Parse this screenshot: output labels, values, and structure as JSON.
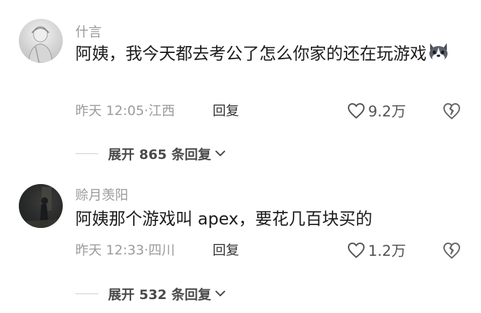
{
  "comments": [
    {
      "username": "什言",
      "text": "阿姨，我今天都去考公了怎么你家的还在玩游戏",
      "emoji": "husky-dog-emoji",
      "time": "昨天 12:05",
      "location": "江西",
      "reply_label": "回复",
      "likes": "9.2万",
      "expand_label": "展开 865 条回复"
    },
    {
      "username": "赊月羡阳",
      "text": "阿姨那个游戏叫 apex，要花几百块买的",
      "time": "昨天 12:33",
      "location": "四川",
      "reply_label": "回复",
      "likes": "1.2万",
      "expand_label": "展开 532 条回复"
    }
  ],
  "meta_separator": "·"
}
